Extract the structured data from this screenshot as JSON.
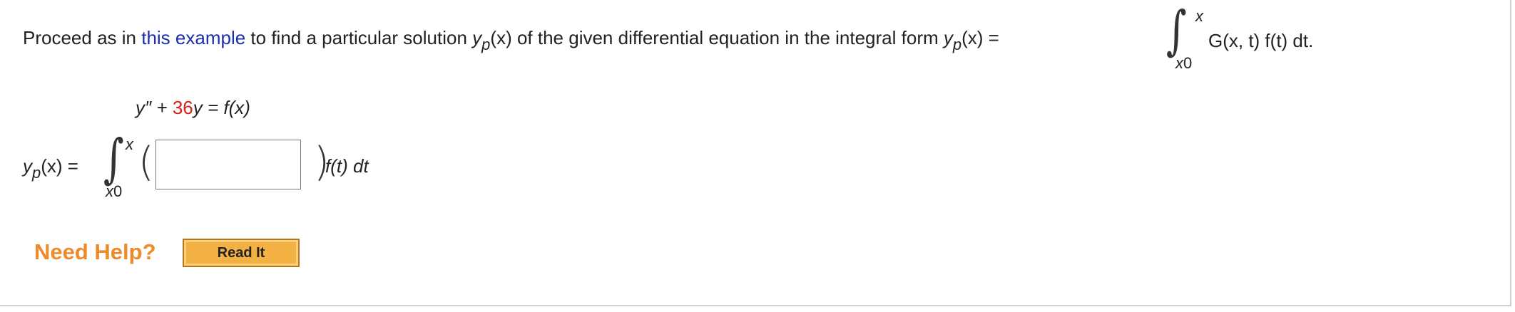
{
  "instruction": {
    "part1": "Proceed as in ",
    "link_text": "this example",
    "part2": " to find a particular solution ",
    "y": "y",
    "p": "p",
    "of_x": "(x)",
    "part3": " of the given differential equation in the integral form ",
    "eq": " = ",
    "upper": "x",
    "lower": "x",
    "lower_sub": "0",
    "integrand": "G(x, t) f(t) dt."
  },
  "equation": {
    "lhs": "y″ + ",
    "coef": "36",
    "rhs": "y = f(x)"
  },
  "solution": {
    "y": "y",
    "p": "p",
    "of_x": "(x) = ",
    "upper": "x",
    "lower": "x",
    "lower_sub": "0",
    "open_paren": "(",
    "close_paren": ")",
    "tail": "f(t) dt",
    "answer_value": ""
  },
  "help": {
    "label": "Need Help?",
    "read_button": "Read It"
  },
  "colors": {
    "link": "#1a2fa8",
    "coefficient": "#d62018",
    "help": "#ee8a2a",
    "button": "#f3b143"
  }
}
